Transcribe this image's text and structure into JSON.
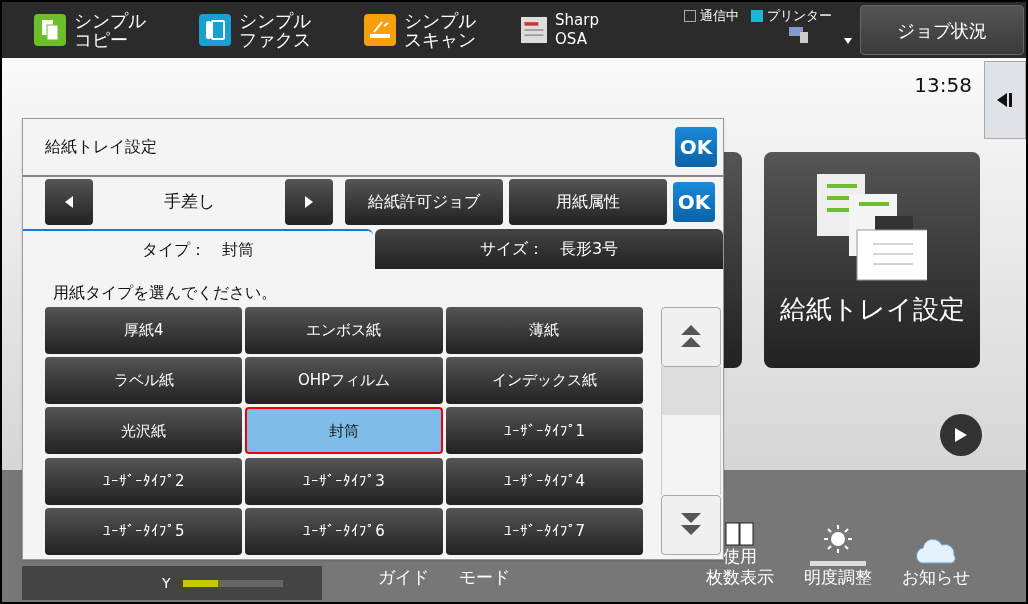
{
  "top_bar": {
    "apps": [
      {
        "kind": "copy",
        "lines": [
          "シンプル",
          "コピー"
        ]
      },
      {
        "kind": "fax",
        "lines": [
          "シンプル",
          "ファクス"
        ]
      },
      {
        "kind": "scan",
        "lines": [
          "シンプル",
          "スキャン"
        ]
      },
      {
        "kind": "osa",
        "lines": [
          "Sharp OSA"
        ]
      }
    ],
    "indicators": [
      {
        "label": "通信中",
        "on": false
      },
      {
        "label": "プリンター",
        "on": true
      }
    ],
    "job_status": "ジョブ状況"
  },
  "home": {
    "time": "13:58",
    "tile": "給紙トレイ設定"
  },
  "bottom_bar": {
    "toner": {
      "label": "Y",
      "level": 0.35
    },
    "items": [
      {
        "kind": "text",
        "lines": [
          "ガイド"
        ]
      },
      {
        "kind": "text",
        "lines": [
          "モード"
        ]
      },
      {
        "kind": "counter",
        "lines": [
          "使用",
          "枚数表示"
        ]
      },
      {
        "kind": "brightness",
        "lines": [
          "明度調整"
        ]
      },
      {
        "kind": "cloud",
        "lines": [
          "お知らせ"
        ]
      }
    ]
  },
  "dialog": {
    "title": "給紙トレイ設定",
    "ok": "OK",
    "tray": "手差し",
    "buttons": [
      "給紙許可ジョブ",
      "用紙属性"
    ],
    "ok2": "OK",
    "tabs": [
      {
        "label": "タイプ：　封筒",
        "selected": true
      },
      {
        "label": "サイズ：　長形3号",
        "selected": false
      }
    ],
    "prompt": "用紙タイプを選んでください。",
    "types": [
      {
        "label": "厚紙4",
        "selected": false
      },
      {
        "label": "エンボス紙",
        "selected": false
      },
      {
        "label": "薄紙",
        "selected": false
      },
      {
        "label": "ラベル紙",
        "selected": false
      },
      {
        "label": "OHPフィルム",
        "selected": false
      },
      {
        "label": "インデックス紙",
        "selected": false
      },
      {
        "label": "光沢紙",
        "selected": false
      },
      {
        "label": "封筒",
        "selected": true
      },
      {
        "label": "ﾕｰｻﾞｰﾀｲﾌﾟ1",
        "selected": false
      },
      {
        "label": "ﾕｰｻﾞｰﾀｲﾌﾟ2",
        "selected": false
      },
      {
        "label": "ﾕｰｻﾞｰﾀｲﾌﾟ3",
        "selected": false
      },
      {
        "label": "ﾕｰｻﾞｰﾀｲﾌﾟ4",
        "selected": false
      },
      {
        "label": "ﾕｰｻﾞｰﾀｲﾌﾟ5",
        "selected": false
      },
      {
        "label": "ﾕｰｻﾞｰﾀｲﾌﾟ6",
        "selected": false
      },
      {
        "label": "ﾕｰｻﾞｰﾀｲﾌﾟ7",
        "selected": false
      }
    ]
  }
}
